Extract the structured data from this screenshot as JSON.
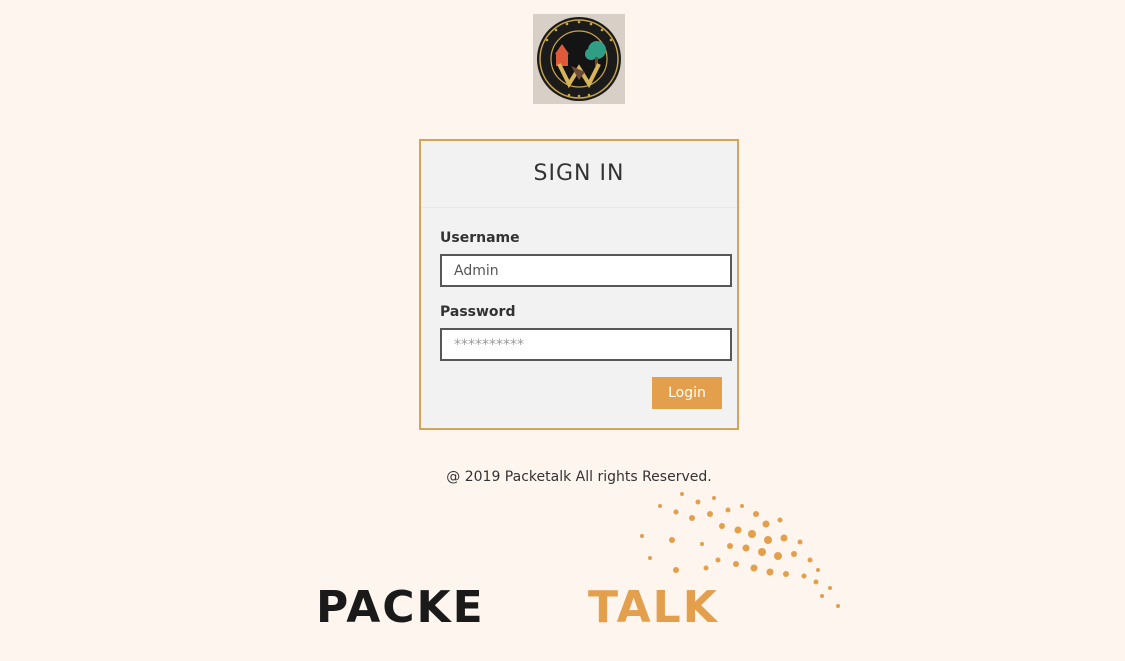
{
  "seal": {
    "label": "Willingboro Township N.J. Police Dept. seal"
  },
  "signin": {
    "title": "SIGN IN",
    "username_label": "Username",
    "username_value": "Admin",
    "password_label": "Password",
    "password_placeholder": "**********",
    "login_label": "Login"
  },
  "footer": {
    "copyright": "@ 2019 Packetalk All rights Reserved."
  },
  "brand": {
    "wordmark_dark": "PACKE",
    "wordmark_orange": "TALK",
    "dark_color": "#1a1a1a",
    "accent_color": "#e39f4c"
  }
}
